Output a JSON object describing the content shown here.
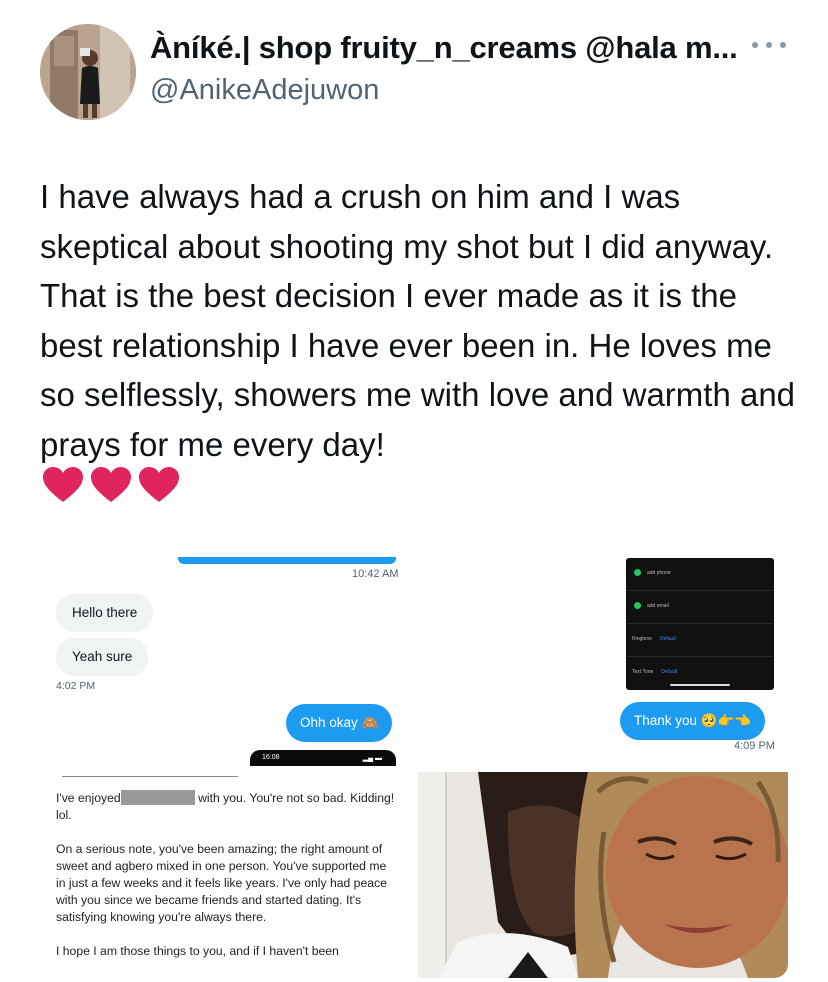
{
  "tweet": {
    "author": {
      "display_name": "Àníké.| shop fruity_n_creams @hala m...",
      "handle": "@AnikeAdejuwon",
      "avatar_icon": "profile-photo"
    },
    "more_icon": "ellipsis-icon",
    "text": "I have always had a crush on him and I was skeptical about shooting my shot but I did anyway. That is the best decision I ever made as it is the best relationship I have ever been in. He loves me so selflessly, showers me with love and warmth and prays for me every day!",
    "hearts": [
      "❤️",
      "❤️",
      "❤️"
    ]
  },
  "media": {
    "chat": {
      "time_top": "10:42 AM",
      "messages_in": [
        "Hello there",
        "Yeah sure"
      ],
      "time_in": "4:02 PM",
      "message_out": "Ohh okay 🙈",
      "phone_status_time": "16:08"
    },
    "settings_screen": {
      "rows": [
        {
          "label": "add phone",
          "value": ""
        },
        {
          "label": "add email",
          "value": ""
        },
        {
          "label": "Ringtone",
          "value": "Default"
        },
        {
          "label": "Text Tone",
          "value": "Default"
        }
      ],
      "reply": "Thank you 🥺👉👈",
      "reply_time": "4:09 PM"
    },
    "letter": {
      "line1_before": "I've enjoyed",
      "line1_after": "with you. You're not so bad. Kidding! lol.",
      "paragraph2": "On a serious note, you've been amazing; the right amount of sweet and agbero mixed in one person. You've supported me in just a few weeks and it feels like years. I've only had peace with you since we became friends and started dating. It's satisfying knowing you're always there.",
      "paragraph3": "I hope I am those things to you, and if I haven't been"
    },
    "photo": {
      "description_icon": "couple-selfie-photo"
    }
  },
  "colors": {
    "text": "#0f1419",
    "secondary": "#536471",
    "accent": "#1d9bf0",
    "heart": "#e0245e"
  }
}
